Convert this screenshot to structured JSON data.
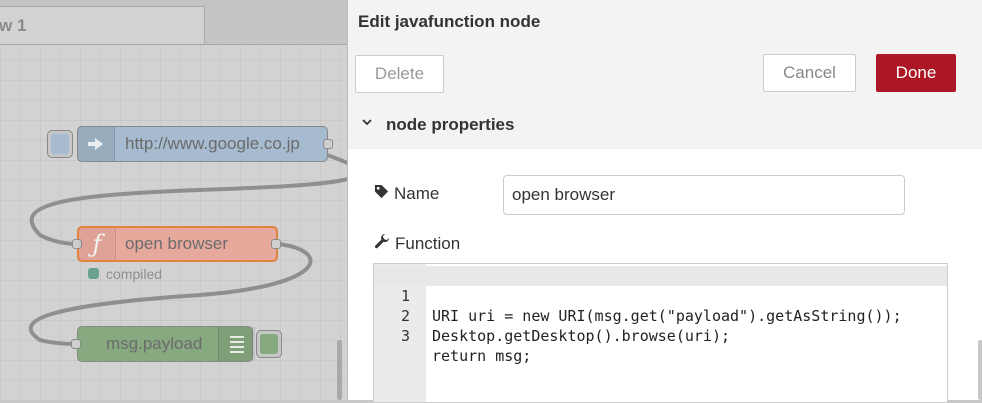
{
  "workspace": {
    "tab_label": "w 1",
    "nodes": {
      "inject": {
        "label": "http://www.google.co.jp",
        "color": "#a6bbcf",
        "icon": "arrow-in-icon"
      },
      "javafunction": {
        "label": "open browser",
        "color": "#fdd0a2",
        "selected_border": "#ff7f0e",
        "icon": "function-icon",
        "status": "compiled",
        "status_color": "#6aa08e"
      },
      "debug": {
        "label": "msg.payload",
        "color": "#87a980",
        "icon": "list-icon"
      }
    }
  },
  "tray": {
    "title": "Edit javafunction node",
    "delete_label": "Delete",
    "cancel_label": "Cancel",
    "done_label": "Done",
    "section_title": "node properties",
    "name_label": "Name",
    "name_value": "open browser",
    "function_label": "Function",
    "code_lines": [
      {
        "no": "1",
        "text": "URI uri = new URI(msg.get(\"payload\").getAsString());"
      },
      {
        "no": "2",
        "text": "Desktop.getDesktop().browse(uri);"
      },
      {
        "no": "3",
        "text": "return msg;"
      }
    ],
    "accent_color": "#ad1625"
  }
}
